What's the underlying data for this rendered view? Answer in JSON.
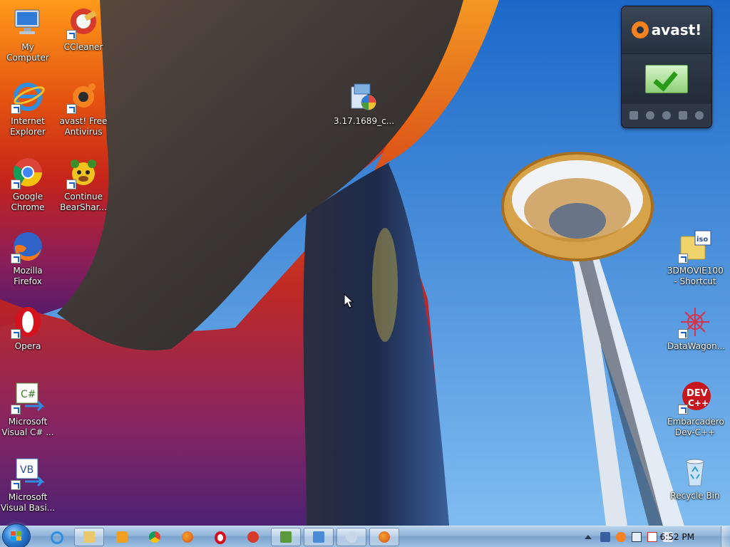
{
  "desktop": {
    "left_icons": [
      {
        "label": "My Computer",
        "icon": "computer-icon"
      },
      {
        "label": "CCleaner",
        "icon": "ccleaner-icon"
      },
      {
        "label": "Internet\nExplorer",
        "icon": "internet-explorer-icon"
      },
      {
        "label": "avast! Free\nAntivirus",
        "icon": "avast-icon"
      },
      {
        "label": "Google\nChrome",
        "icon": "chrome-icon"
      },
      {
        "label": "Continue\nBearShar...",
        "icon": "bearshare-icon"
      },
      {
        "label": "Mozilla\nFirefox",
        "icon": "firefox-icon"
      },
      {
        "label": "Opera",
        "icon": "opera-icon"
      },
      {
        "label": "Microsoft\nVisual C# ...",
        "icon": "visual-csharp-icon"
      },
      {
        "label": "Microsoft\nVisual Basi...",
        "icon": "visual-basic-icon"
      }
    ],
    "center_icon": {
      "label": "3.17.1689_c...",
      "icon": "installer-icon"
    },
    "right_icons": [
      {
        "label": "3DMOVIE100\n- Shortcut",
        "icon": "iso-folder-icon"
      },
      {
        "label": "DataWagon...",
        "icon": "datawagon-icon"
      },
      {
        "label": "Embarcadero\nDev-C++",
        "icon": "devcpp-icon"
      },
      {
        "label": "Recycle Bin",
        "icon": "recycle-bin-icon"
      }
    ]
  },
  "avast_widget": {
    "brand": "avast!",
    "status_icon": "check-icon",
    "footer_icons": [
      "window-icon",
      "refresh-icon",
      "twitter-icon",
      "facebook-icon",
      "rss-icon"
    ]
  },
  "taskbar": {
    "pinned": [
      {
        "name": "internet-explorer",
        "icon": "internet-explorer-icon"
      },
      {
        "name": "windows-explorer",
        "icon": "folder-icon"
      },
      {
        "name": "media-player",
        "icon": "media-player-icon"
      },
      {
        "name": "chrome",
        "icon": "chrome-icon"
      },
      {
        "name": "firefox",
        "icon": "firefox-icon"
      },
      {
        "name": "opera",
        "icon": "opera-icon"
      },
      {
        "name": "ccleaner",
        "icon": "ccleaner-icon"
      },
      {
        "name": "visual-csharp",
        "icon": "visual-csharp-icon"
      },
      {
        "name": "remote-desktop",
        "icon": "monitor-icon"
      },
      {
        "name": "paint",
        "icon": "paint-icon"
      },
      {
        "name": "firefox-running",
        "icon": "firefox-icon"
      }
    ],
    "tray_icons": [
      "show-hidden-icon",
      "network-icon",
      "avast-tray-icon",
      "action-center-icon",
      "wifi-icon",
      "flag-icon",
      "volume-icon"
    ],
    "clock": "6:52 PM"
  }
}
